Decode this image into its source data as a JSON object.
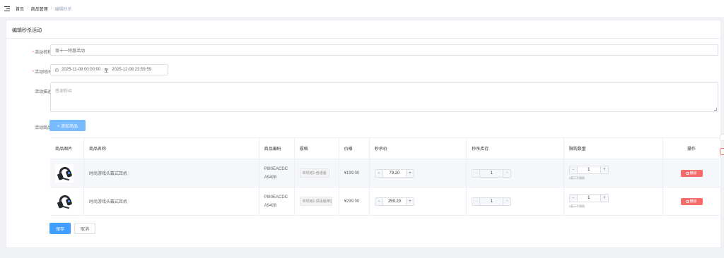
{
  "breadcrumb": [
    "首页",
    "商品管理",
    "编辑秒杀"
  ],
  "breadcrumb_sep": "/",
  "card_title": "编辑秒杀活动",
  "form": {
    "name_label": "活动名称",
    "name_value": "双十一特惠活动",
    "time_label": "活动时间",
    "start_time": "2025-11-08 00:00:00",
    "range_sep": "至",
    "end_time": "2025-12-08 23:59:59",
    "desc_label": "活动描述",
    "desc_placeholder": "感谢粉丝",
    "goods_label": "活动商品",
    "add_button": "+ 添加商品"
  },
  "table": {
    "headers": [
      "商品图片",
      "商品名称",
      "商品编码",
      "规格",
      "价格",
      "秒杀价",
      "秒杀库存",
      "限购数量",
      "操作"
    ],
    "rows": [
      {
        "name": "时尚游戏头戴式耳机",
        "code": "P8I0EACDCA9408",
        "spec": "单规格1:普通版",
        "price": "¥199.00",
        "seckill_price": "79.20",
        "stock": "1",
        "limit": "1",
        "limit_hint": "0表示不限购",
        "delete": "删除"
      },
      {
        "name": "时尚游戏头戴式耳机",
        "code": "P8I0EACDCA9408",
        "spec": "单规格1:高级版带显示屏",
        "price": "¥299.00",
        "seckill_price": "159.20",
        "stock": "1",
        "limit": "1",
        "limit_hint": "0表示不限购",
        "delete": "删除"
      }
    ]
  },
  "footer": {
    "save": "保存",
    "cancel": "取消"
  },
  "colors": {
    "primary": "#409eff",
    "danger": "#f56c6c",
    "required": "#f56c6c"
  }
}
